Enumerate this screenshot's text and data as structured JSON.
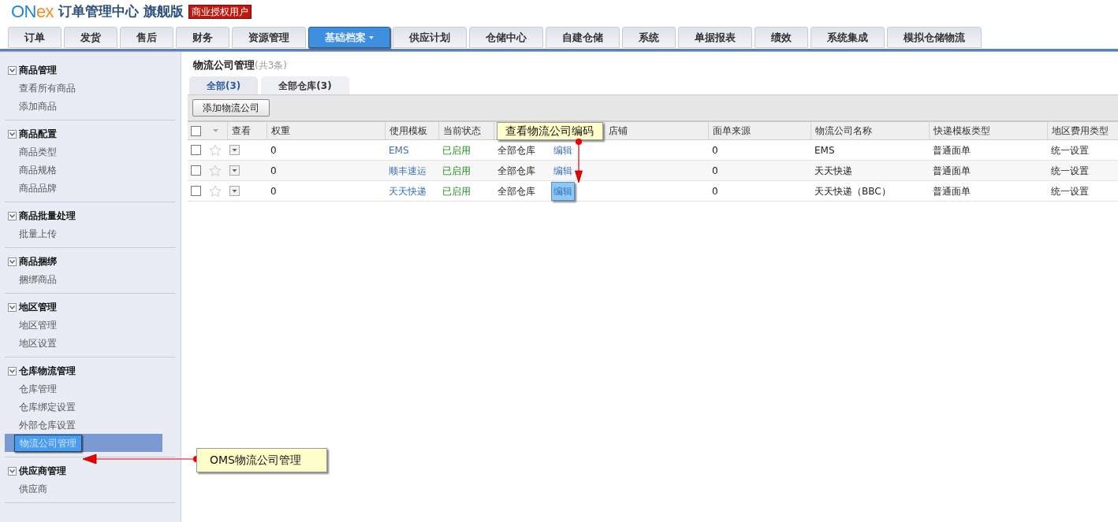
{
  "header": {
    "logo": [
      {
        "text": "ON",
        "color": "#1e88d6"
      },
      {
        "text": "ex",
        "color": "#f28b1e"
      }
    ],
    "title": "订单管理中心 旗舰版",
    "badge": "商业授权用户"
  },
  "nav_tabs": [
    {
      "label": "订单",
      "selected": false
    },
    {
      "label": "发货",
      "selected": false
    },
    {
      "label": "售后",
      "selected": false
    },
    {
      "label": "财务",
      "selected": false
    },
    {
      "label": "资源管理",
      "selected": false
    },
    {
      "label": "基础档案",
      "selected": true,
      "has_menu": true
    },
    {
      "label": "供应计划",
      "selected": false
    },
    {
      "label": "仓储中心",
      "selected": false
    },
    {
      "label": "自建仓储",
      "selected": false
    },
    {
      "label": "系统",
      "selected": false
    },
    {
      "label": "单据报表",
      "selected": false
    },
    {
      "label": "绩效",
      "selected": false
    },
    {
      "label": "系统集成",
      "selected": false
    },
    {
      "label": "模拟仓储物流",
      "selected": false
    }
  ],
  "sidebar": [
    {
      "title": "商品管理",
      "expanded": true,
      "items": [
        {
          "label": "查看所有商品",
          "selected": false
        },
        {
          "label": "添加商品",
          "selected": false
        }
      ]
    },
    {
      "title": "商品配置",
      "expanded": true,
      "items": [
        {
          "label": "商品类型",
          "selected": false
        },
        {
          "label": "商品规格",
          "selected": false
        },
        {
          "label": "商品品牌",
          "selected": false
        }
      ]
    },
    {
      "title": "商品批量处理",
      "expanded": true,
      "items": [
        {
          "label": "批量上传",
          "selected": false
        }
      ]
    },
    {
      "title": "商品捆绑",
      "expanded": true,
      "items": [
        {
          "label": "捆绑商品",
          "selected": false
        }
      ]
    },
    {
      "title": "地区管理",
      "expanded": true,
      "items": [
        {
          "label": "地区管理",
          "selected": false
        },
        {
          "label": "地区设置",
          "selected": false
        }
      ]
    },
    {
      "title": "仓库物流管理",
      "expanded": true,
      "items": [
        {
          "label": "仓库管理",
          "selected": false
        },
        {
          "label": "仓库绑定设置",
          "selected": false
        },
        {
          "label": "外部仓库设置",
          "selected": false
        },
        {
          "label": "物流公司管理",
          "selected": true
        }
      ]
    },
    {
      "title": "供应商管理",
      "expanded": true,
      "items": [
        {
          "label": "供应商",
          "selected": false
        }
      ]
    }
  ],
  "page": {
    "title": "物流公司管理",
    "count": "(共3条)"
  },
  "sub_tabs": [
    {
      "label": "全部(3)",
      "selected": true
    },
    {
      "label": "全部仓库(3)",
      "selected": false
    }
  ],
  "add_button": "添加物流公司",
  "table": {
    "select_all_checked": false,
    "columns": [
      "查看",
      "权重",
      "使用模板",
      "当前状态",
      "",
      "",
      "店铺",
      "面单来源",
      "物流公司名称",
      "快递模板类型",
      "地区费用类型"
    ],
    "rows": [
      {
        "checked": false,
        "starred": false,
        "weight": "0",
        "template": "EMS",
        "status": "已启用",
        "warehouse": "全部仓库",
        "action": "编辑",
        "action_highlighted": false,
        "source": "0",
        "company": "EMS",
        "template_type": "普通面单",
        "fee_type": "统一设置"
      },
      {
        "checked": false,
        "starred": false,
        "weight": "0",
        "template": "顺丰速运",
        "status": "已启用",
        "warehouse": "全部仓库",
        "action": "编辑",
        "action_highlighted": false,
        "source": "0",
        "company": "天天快递",
        "template_type": "普通面单",
        "fee_type": "统一设置"
      },
      {
        "checked": false,
        "starred": false,
        "weight": "0",
        "template": "天天快递",
        "status": "已启用",
        "warehouse": "全部仓库",
        "action": "编辑",
        "action_highlighted": true,
        "source": "0",
        "company": "天天快递（BBC）",
        "template_type": "普通面单",
        "fee_type": "统一设置"
      }
    ]
  },
  "callouts": [
    {
      "text": "查看物流公司编码"
    },
    {
      "text": "OMS物流公司管理"
    }
  ]
}
